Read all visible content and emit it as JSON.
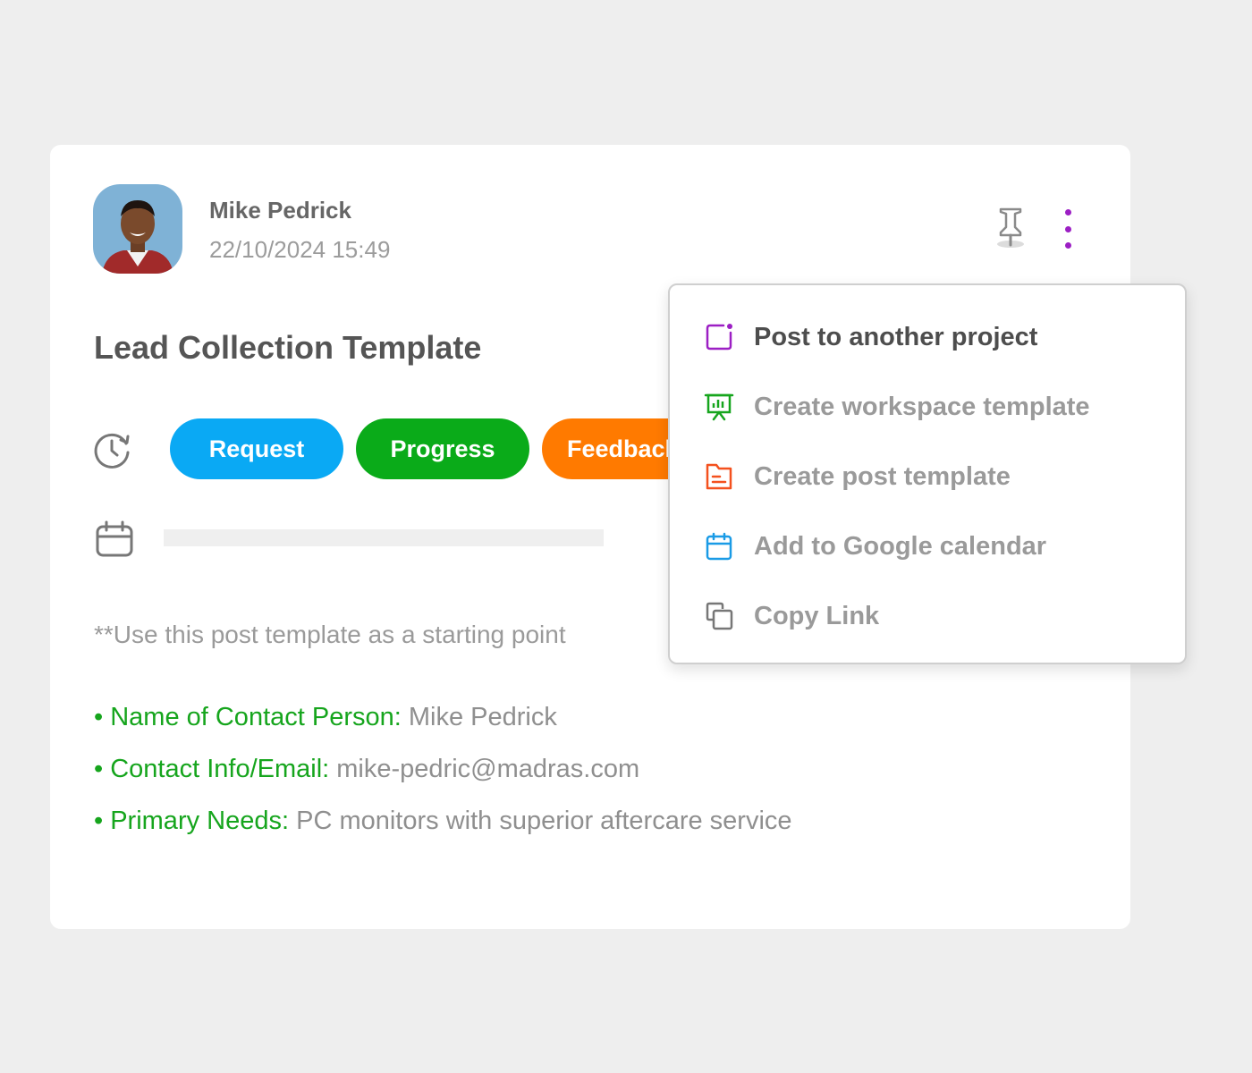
{
  "post": {
    "author": "Mike Pedrick",
    "timestamp": "22/10/2024 15:49",
    "title": "Lead Collection Template",
    "statuses": [
      "Request",
      "Progress",
      "Feedback"
    ],
    "status_colors": {
      "request": "#0aa9f4",
      "progress": "#0aab19",
      "feedback": "#ff7a00"
    },
    "intro": "**Use this post template as a starting point",
    "fields": [
      {
        "label": "• Name of Contact Person:",
        "value": " Mike Pedrick"
      },
      {
        "label": "• Contact Info/Email:",
        "value": " mike-pedric@madras.com"
      },
      {
        "label": "• Primary Needs:",
        "value": " PC monitors with superior aftercare service"
      }
    ],
    "icons": {
      "pin": "pin-icon",
      "more": "more-vertical-icon",
      "status": "history-icon",
      "date": "calendar-icon"
    }
  },
  "menu": {
    "items": [
      {
        "label": "Post to another project",
        "icon": "post-to-project-icon",
        "color": "#9c1fc4"
      },
      {
        "label": "Create workspace template",
        "icon": "presentation-chart-icon",
        "color": "#16a51d"
      },
      {
        "label": "Create post template",
        "icon": "document-icon",
        "color": "#f4511e"
      },
      {
        "label": "Add to Google calendar",
        "icon": "calendar-icon",
        "color": "#1a9be6"
      },
      {
        "label": "Copy Link",
        "icon": "copy-icon",
        "color": "#777777"
      }
    ]
  }
}
